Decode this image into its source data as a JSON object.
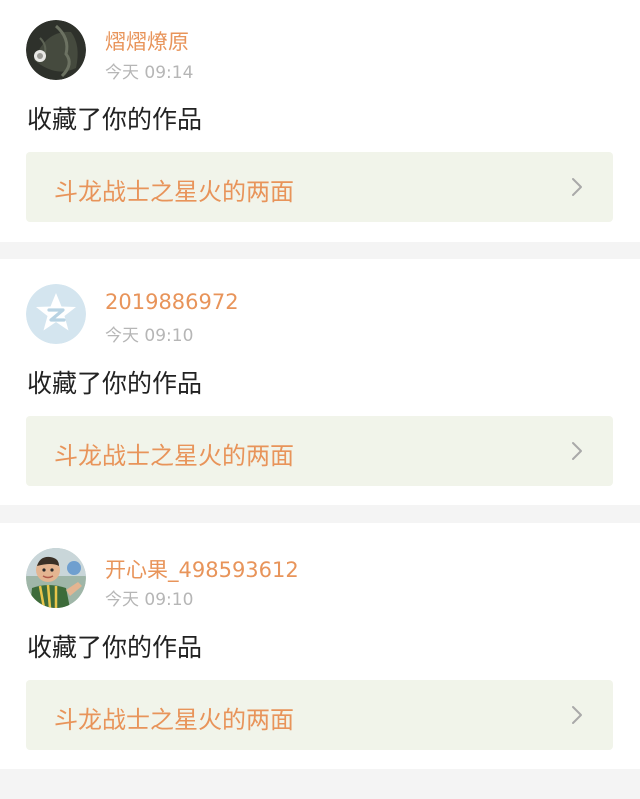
{
  "notifications": [
    {
      "username": "熠熠燎原",
      "time": "今天 09:14",
      "message": "收藏了你的作品",
      "work_title": "斗龙战士之星火的两面",
      "avatar": "dark-photo-avatar"
    },
    {
      "username": "2019886972",
      "time": "今天 09:10",
      "message": "收藏了你的作品",
      "work_title": "斗龙战士之星火的两面",
      "avatar": "default-star-avatar"
    },
    {
      "username": "开心果_498593612",
      "time": "今天 09:10",
      "message": "收藏了你的作品",
      "work_title": "斗龙战士之星火的两面",
      "avatar": "child-photo-avatar"
    }
  ],
  "colors": {
    "accent": "#e8945a",
    "time_text": "#b6b6b6",
    "work_bg": "#f1f4ea",
    "separator": "#f4f4f4"
  }
}
